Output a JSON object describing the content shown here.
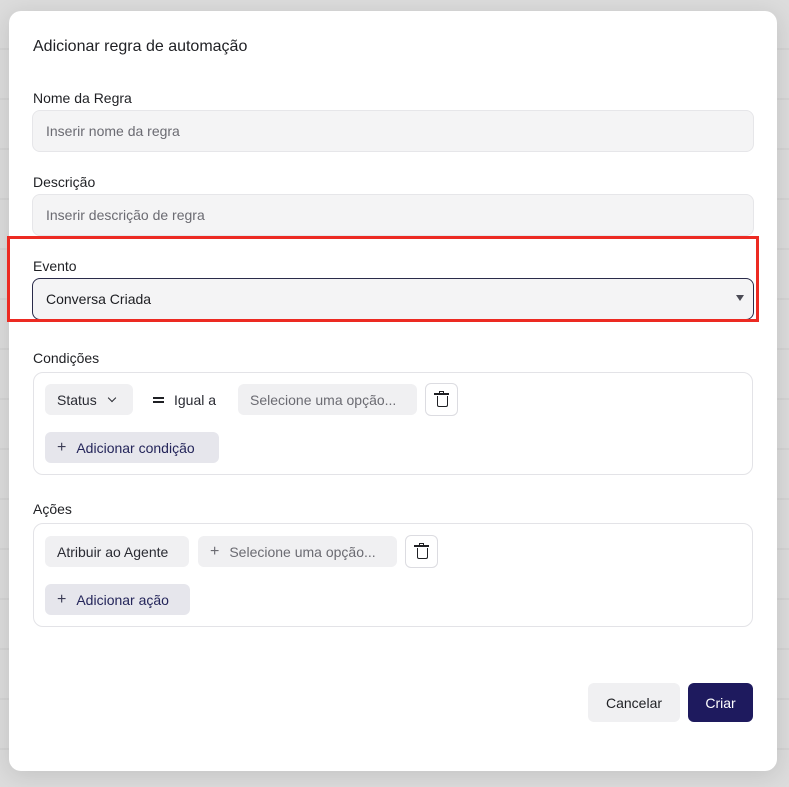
{
  "modal": {
    "title": "Adicionar regra de automação"
  },
  "rule_name": {
    "label": "Nome da Regra",
    "placeholder": "Inserir nome da regra"
  },
  "description": {
    "label": "Descrição",
    "placeholder": "Inserir descrição de regra"
  },
  "event": {
    "label": "Evento",
    "selected": "Conversa Criada"
  },
  "conditions": {
    "label": "Condições",
    "attribute": "Status",
    "operator": "Igual a",
    "value_placeholder": "Selecione uma opção...",
    "add_label": "Adicionar condição"
  },
  "actions": {
    "label": "Ações",
    "action": "Atribuir ao Agente",
    "value_placeholder": "Selecione uma opção...",
    "add_label": "Adicionar ação"
  },
  "footer": {
    "cancel_label": "Cancelar",
    "create_label": "Criar"
  },
  "colors": {
    "highlight": "#ec2a22",
    "primary": "#1e1a5e"
  }
}
